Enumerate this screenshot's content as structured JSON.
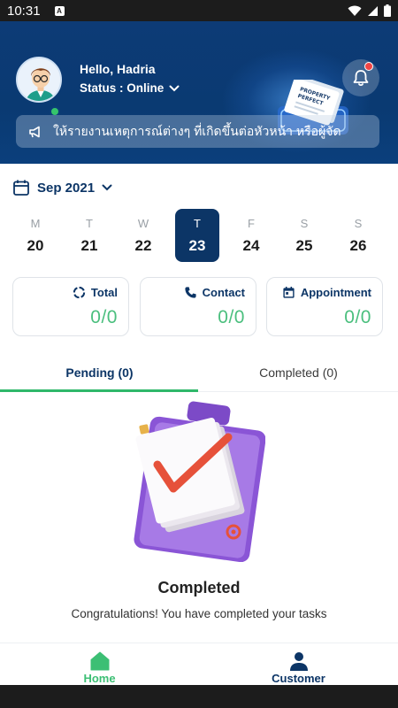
{
  "statusbar": {
    "time": "10:31",
    "sim_label": "A"
  },
  "header": {
    "greeting": "Hello, Hadria",
    "status_text": "Status : Online",
    "announcement": "ให้รายงานเหตุการณ์ต่างๆ ที่เกิดขึ้นต่อหัวหน้า หรือผู้จัด",
    "doc_label": "PROPERTY PERFECT"
  },
  "calendar": {
    "month_label": "Sep 2021",
    "days": [
      {
        "dow": "M",
        "num": "20",
        "selected": false
      },
      {
        "dow": "T",
        "num": "21",
        "selected": false
      },
      {
        "dow": "W",
        "num": "22",
        "selected": false
      },
      {
        "dow": "T",
        "num": "23",
        "selected": true
      },
      {
        "dow": "F",
        "num": "24",
        "selected": false
      },
      {
        "dow": "S",
        "num": "25",
        "selected": false
      },
      {
        "dow": "S",
        "num": "26",
        "selected": false
      }
    ]
  },
  "cards": [
    {
      "title": "Total",
      "value": "0/0",
      "icon": "progress-ring-icon"
    },
    {
      "title": "Contact",
      "value": "0/0",
      "icon": "phone-icon"
    },
    {
      "title": "Appointment",
      "value": "0/0",
      "icon": "calendar-check-icon"
    }
  ],
  "tabs": [
    {
      "label": "Pending (0)",
      "active": true
    },
    {
      "label": "Completed (0)",
      "active": false
    }
  ],
  "empty_state": {
    "title": "Completed",
    "subtitle": "Congratulations! You have completed your tasks"
  },
  "bottom_nav": [
    {
      "label": "Home",
      "icon": "home-icon",
      "active": true
    },
    {
      "label": "Customer",
      "icon": "person-icon",
      "active": false
    }
  ],
  "colors": {
    "primary": "#0c3566",
    "accent_green": "#3cbf74",
    "value_green": "#4bbf7e",
    "header_bg": "#0d3b76",
    "notification_dot": "#f04545"
  }
}
